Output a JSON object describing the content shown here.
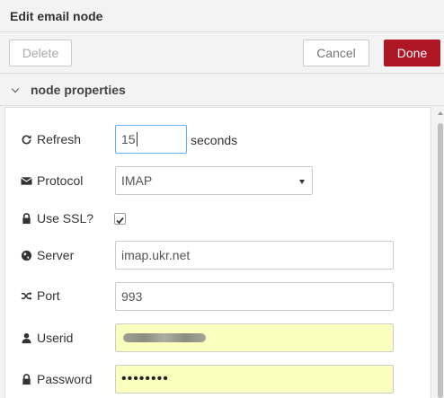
{
  "tray": {
    "title": "Edit email node"
  },
  "toolbar": {
    "delete_label": "Delete",
    "cancel_label": "Cancel",
    "done_label": "Done"
  },
  "section": {
    "title": "node properties",
    "expanded": true
  },
  "fields": {
    "refresh": {
      "label": "Refresh",
      "value": "15",
      "suffix": "seconds",
      "icon": "refresh-icon"
    },
    "protocol": {
      "label": "Protocol",
      "value": "IMAP",
      "icon": "envelope-icon"
    },
    "use_ssl": {
      "label": "Use SSL?",
      "checked": true,
      "icon": "lock-icon"
    },
    "server": {
      "label": "Server",
      "value": "imap.ukr.net",
      "icon": "globe-icon"
    },
    "port": {
      "label": "Port",
      "value": "993",
      "icon": "random-icon"
    },
    "userid": {
      "label": "Userid",
      "value_obscured": true,
      "icon": "user-icon"
    },
    "password": {
      "label": "Password",
      "value": "••••••••",
      "icon": "lock-icon"
    }
  },
  "colors": {
    "done_button": "#ad1625",
    "autofill": "#faffbd",
    "focus_border": "#66afe9"
  }
}
